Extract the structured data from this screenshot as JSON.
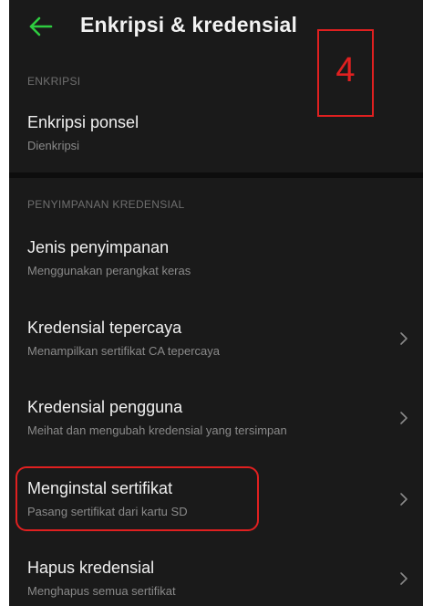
{
  "appbar": {
    "title": "Enkripsi & kredensial",
    "back_icon": "arrow-left-icon",
    "accent_color": "#2ecc40"
  },
  "sections": {
    "encryption_header": "ENKRIPSI",
    "storage_header": "PENYIMPANAN KREDENSIAL"
  },
  "items": {
    "phone_encryption": {
      "title": "Enkripsi ponsel",
      "subtitle": "Dienkripsi"
    },
    "storage_type": {
      "title": "Jenis penyimpanan",
      "subtitle": "Menggunakan perangkat keras"
    },
    "trusted_credentials": {
      "title": "Kredensial tepercaya",
      "subtitle": "Menampilkan sertifikat CA tepercaya"
    },
    "user_credentials": {
      "title": "Kredensial pengguna",
      "subtitle": "Meihat dan mengubah kredensial yang tersimpan"
    },
    "install_certificate": {
      "title": "Menginstal sertifikat",
      "subtitle": "Pasang sertifikat dari kartu SD"
    },
    "clear_credentials": {
      "title": "Hapus kredensial",
      "subtitle": "Menghapus semua sertifikat"
    }
  },
  "annotation": {
    "step_number": "4",
    "color": "#e02020"
  }
}
